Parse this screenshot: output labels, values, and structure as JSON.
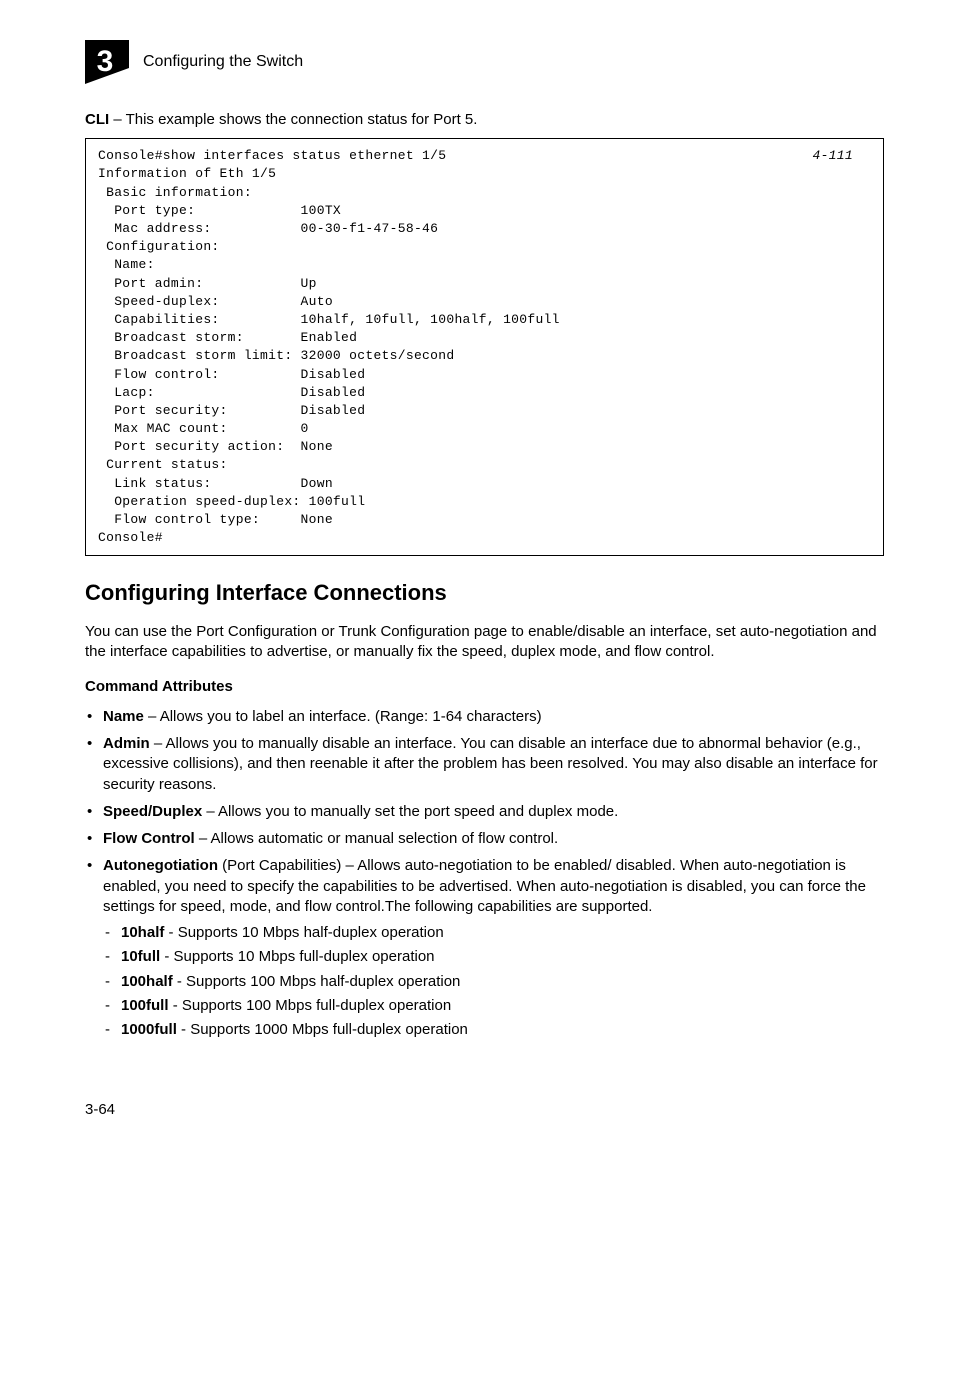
{
  "header": {
    "chapter_number": "3",
    "title": "Configuring the Switch"
  },
  "cli_intro": {
    "label": "CLI",
    "text": " – This example shows the connection status for Port 5."
  },
  "code_ref": "4-111",
  "code_lines": {
    "l1": "Console#show interfaces status ethernet 1/5",
    "l2": "Information of Eth 1/5",
    "l3": " Basic information:",
    "l4": "  Port type:             100TX",
    "l5": "  Mac address:           00-30-f1-47-58-46",
    "l6": " Configuration:",
    "l7": "  Name:",
    "l8": "  Port admin:            Up",
    "l9": "  Speed-duplex:          Auto",
    "l10": "  Capabilities:          10half, 10full, 100half, 100full",
    "l11": "  Broadcast storm:       Enabled",
    "l12": "  Broadcast storm limit: 32000 octets/second",
    "l13": "  Flow control:          Disabled",
    "l14": "  Lacp:                  Disabled",
    "l15": "  Port security:         Disabled",
    "l16": "  Max MAC count:         0",
    "l17": "  Port security action:  None",
    "l18": " Current status:",
    "l19": "  Link status:           Down",
    "l20": "  Operation speed-duplex: 100full",
    "l21": "  Flow control type:     None",
    "l22": "Console#"
  },
  "section": {
    "heading": "Configuring Interface Connections",
    "intro": "You can use the Port Configuration or Trunk Configuration page to enable/disable an interface, set auto-negotiation and the interface capabilities to advertise, or manually fix the speed, duplex mode, and flow control.",
    "subheading": "Command Attributes"
  },
  "bullets": [
    {
      "term": "Name",
      "text": " – Allows you to label an interface. (Range: 1-64 characters)"
    },
    {
      "term": "Admin",
      "text": " – Allows you to manually disable an interface. You can disable an interface due to abnormal behavior (e.g., excessive collisions), and then reenable it after the problem has been resolved. You may also disable an interface for security reasons."
    },
    {
      "term": "Speed/Duplex",
      "text": " – Allows you to manually set the port speed and duplex mode."
    },
    {
      "term": "Flow Control",
      "text": " – Allows automatic or manual selection of flow control."
    },
    {
      "term": "Autonegotiation",
      "text_a": " (Port Capabilities) – Allows auto-negotiation to be enabled/ disabled. When auto-negotiation is enabled, you need to specify the capabilities to be advertised. When auto-negotiation is disabled, you can force the settings for speed, mode, and flow control.The following capabilities are supported."
    }
  ],
  "subbullets": [
    {
      "term": "10half",
      "text": " - Supports 10 Mbps half-duplex operation"
    },
    {
      "term": "10full",
      "text": " - Supports 10 Mbps full-duplex operation"
    },
    {
      "term": "100half",
      "text": " - Supports 100 Mbps half-duplex operation"
    },
    {
      "term": "100full",
      "text": " - Supports 100 Mbps full-duplex operation"
    },
    {
      "term": "1000full",
      "text": " - Supports 1000 Mbps full-duplex operation"
    }
  ],
  "page_number": "3-64"
}
